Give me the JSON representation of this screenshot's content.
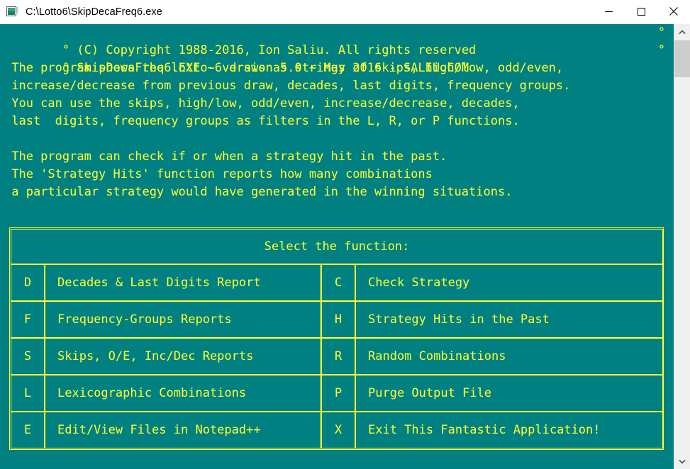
{
  "window": {
    "title": "C:\\Lotto6\\SkipDecaFreq6.exe",
    "icon": "console-window-icon",
    "minimize_label": "Minimize",
    "maximize_label": "Maximize",
    "close_label": "Close"
  },
  "colors": {
    "console_background": "#008080",
    "console_text": "#ffff33",
    "titlebar_background": "#ffffff",
    "titlebar_accent": "#0c7c7c",
    "scrollbar_track": "#f0f0f0",
    "scrollbar_thumb": "#cdcdcd"
  },
  "console": {
    "header": [
      {
        "bullet": "°",
        "text": " (C) Copyright 1988-2016, Ion Saliu. All rights reserved",
        "bullet_right": "°"
      },
      {
        "bullet": "°",
        "text": " SkipDecaFreq6.EXE ~ version 5.0 ~ May 2016 - SALIU.COM",
        "bullet_right": "°"
      }
    ],
    "paragraph1": [
      " The program shows the lotto-6 draws as strings of skips, high/low, odd/even,",
      " increase/decrease from previous draw, decades, last digits, frequency groups.",
      " You can use the skips, high/low, odd/even, increase/decrease, decades,",
      " last  digits, frequency groups as filters in the L, R, or P functions."
    ],
    "paragraph2": [
      " The program can check if or when a strategy hit in the past.",
      " The 'Strategy Hits' function reports how many combinations",
      " a particular strategy would have generated in the winning situations."
    ]
  },
  "menu": {
    "title": "Select the function:",
    "rows": [
      {
        "left": {
          "key": "D",
          "label": "Decades & Last Digits Report"
        },
        "right": {
          "key": "C",
          "label": "Check Strategy"
        }
      },
      {
        "left": {
          "key": "F",
          "label": "Frequency-Groups Reports"
        },
        "right": {
          "key": "H",
          "label": "Strategy Hits in the Past"
        }
      },
      {
        "left": {
          "key": "S",
          "label": "Skips, O/E, Inc/Dec Reports"
        },
        "right": {
          "key": "R",
          "label": "Random Combinations"
        }
      },
      {
        "left": {
          "key": "L",
          "label": "Lexicographic Combinations"
        },
        "right": {
          "key": "P",
          "label": "Purge Output File"
        }
      },
      {
        "left": {
          "key": "E",
          "label": "Edit/View Files in Notepad++"
        },
        "right": {
          "key": "X",
          "label": "Exit This Fantastic Application!"
        }
      }
    ]
  },
  "scrollbar": {
    "up_arrow": "scroll-up-arrow",
    "down_arrow": "scroll-down-arrow",
    "thumb": "scroll-thumb"
  }
}
